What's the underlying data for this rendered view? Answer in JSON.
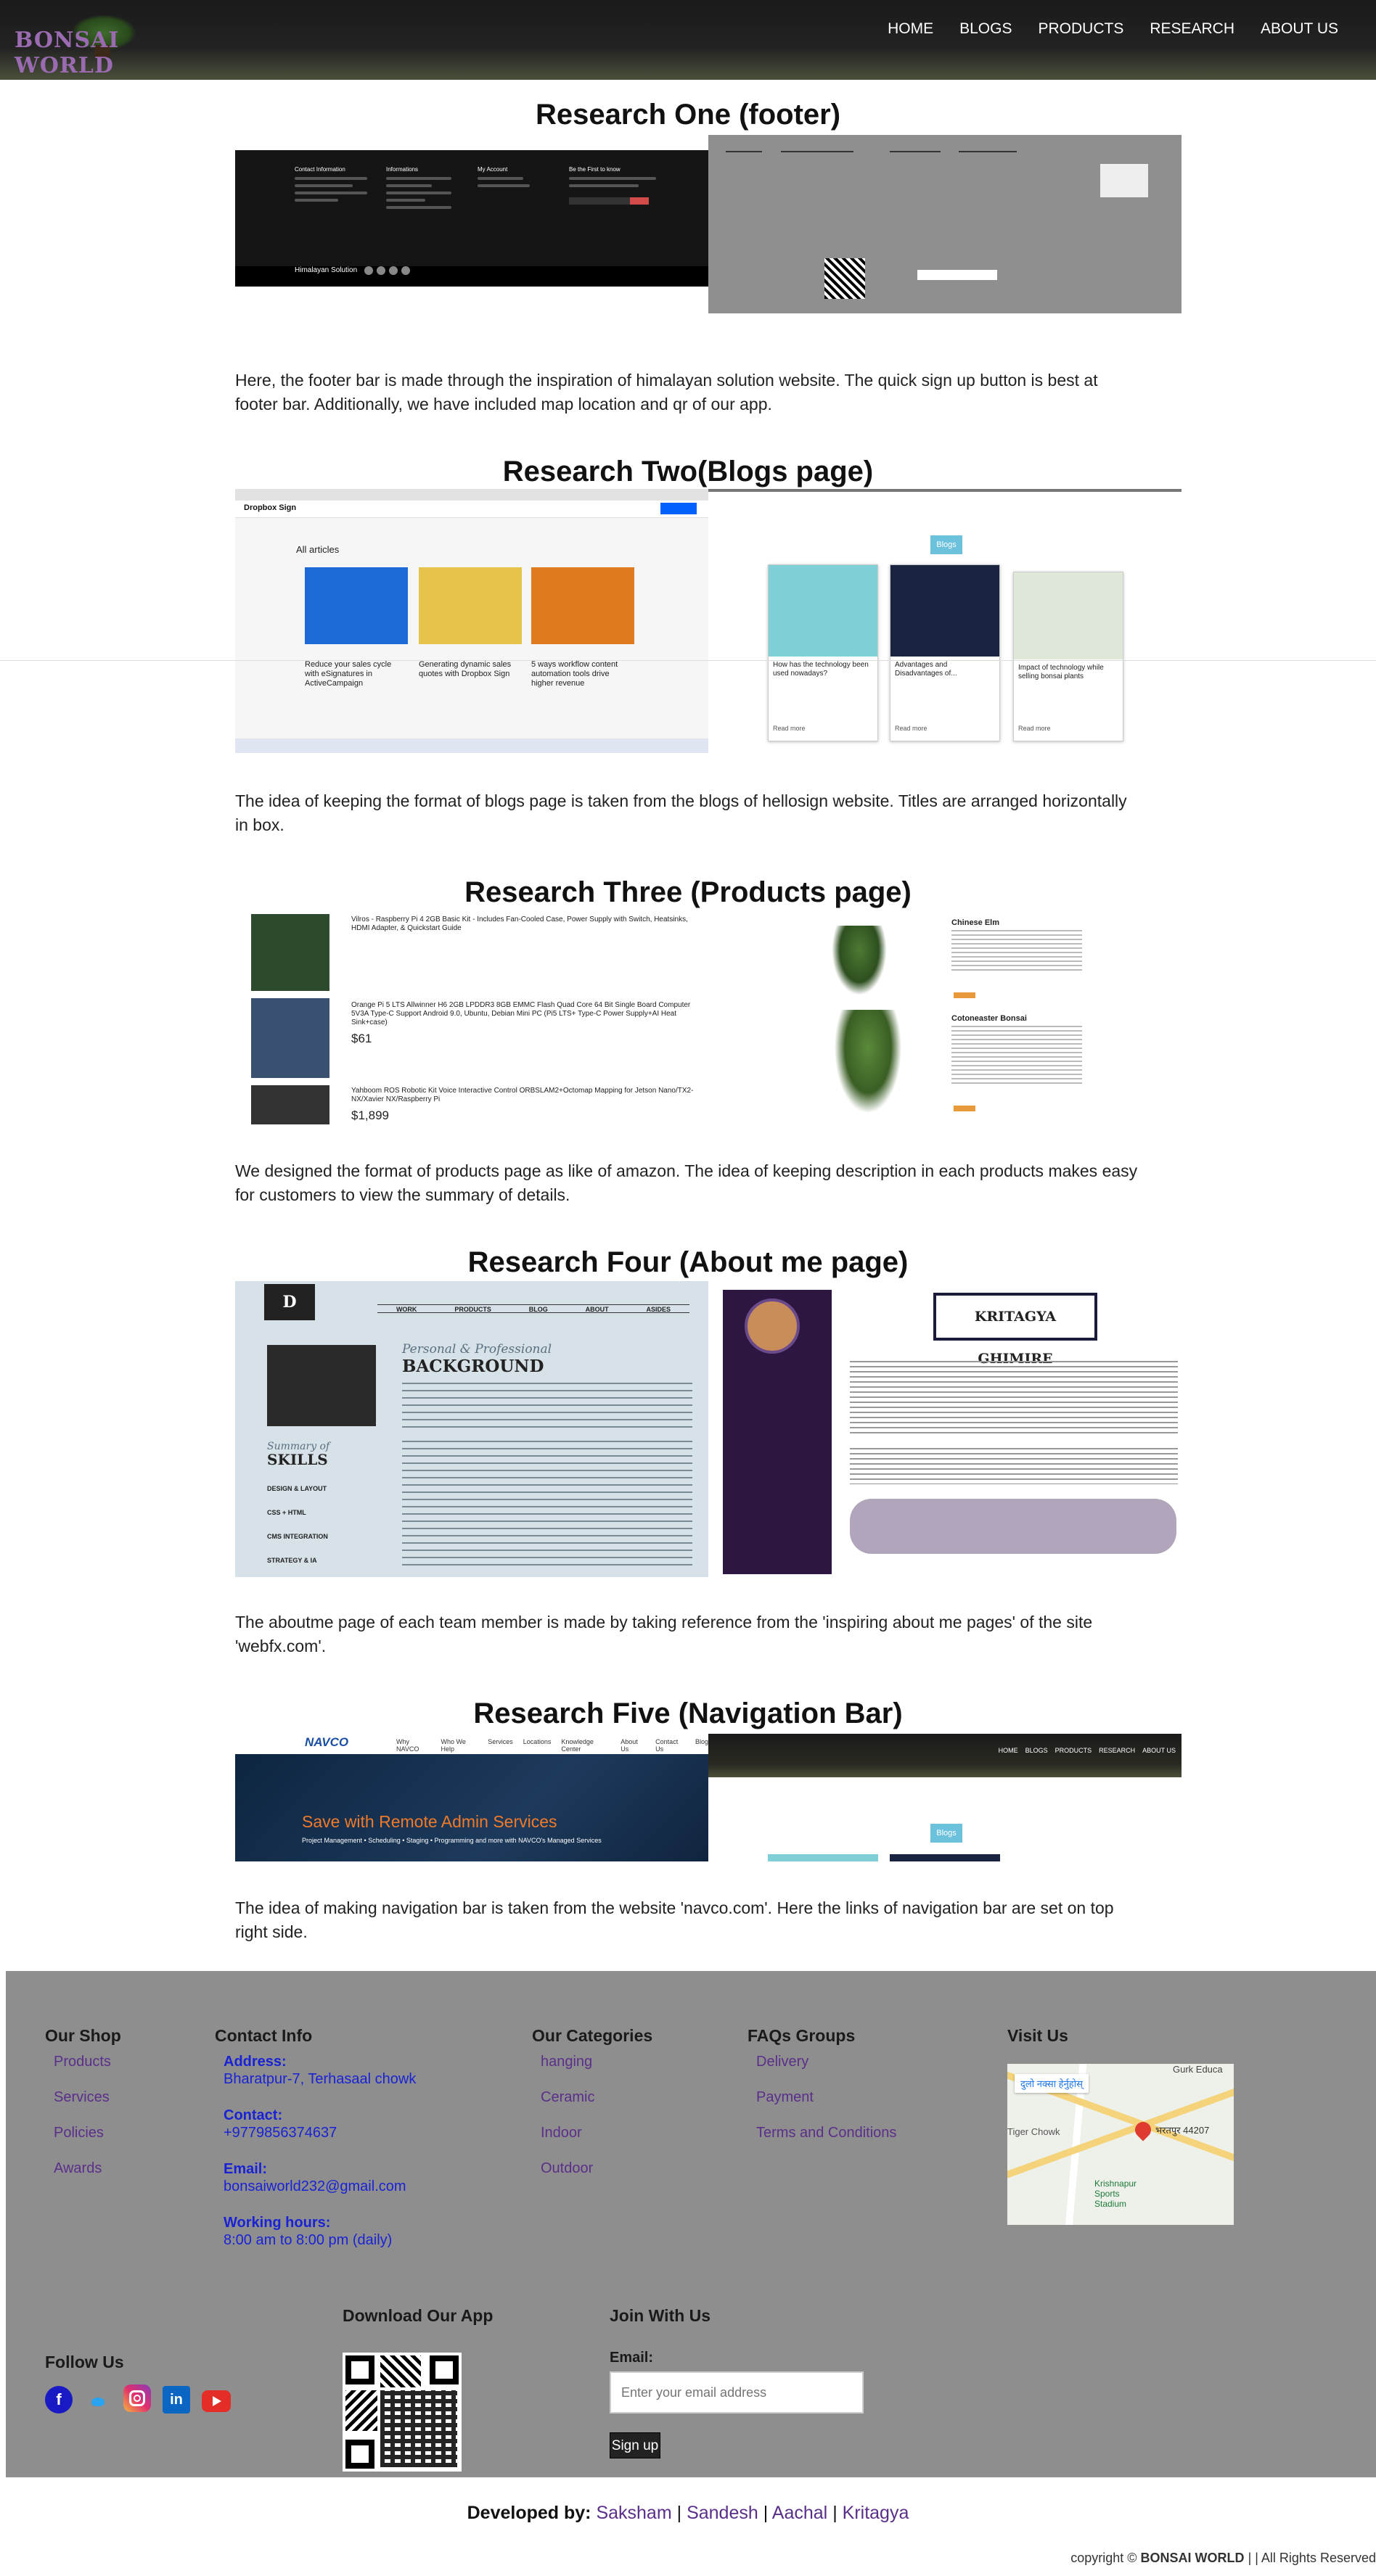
{
  "nav": {
    "logo_text": "BONSAI WORLD",
    "links": [
      "HOME",
      "BLOGS",
      "PRODUCTS",
      "RESEARCH",
      "ABOUT US"
    ]
  },
  "research": [
    {
      "title": "Research One (footer)",
      "text": "Here, the footer bar is made through the inspiration of himalayan solution website. The quick sign up button is best at footer bar. Additionally, we have included map location and qr of our app."
    },
    {
      "title": "Research Two(Blogs page)",
      "text": "The idea of keeping the format of blogs page is taken from the blogs of hellosign website. Titles are arranged horizontally in box."
    },
    {
      "title": "Research Three (Products page)",
      "text": "We designed the format of products page as like of amazon. The idea of keeping description in each products makes easy for customers to view the summary of details."
    },
    {
      "title": "Research Four (About me page)",
      "text": "The aboutme page of each team member is made by taking reference from the 'inspiring about me pages' of the site 'webfx.com'."
    },
    {
      "title": "Research Five (Navigation Bar)",
      "text": "The idea of making navigation bar is taken from the website 'navco.com'. Here the links of navigation bar are set on top right side."
    }
  ],
  "shots": {
    "himalayan_footer_label": "Himalayan Solution",
    "dropbox_heading": "All articles",
    "dropbox_brand": "Dropbox Sign",
    "dropbox_titles": [
      "Reduce your sales cycle with eSignatures in ActiveCampaign",
      "Generating dynamic sales quotes with Dropbox Sign",
      "5 ways workflow content automation tools drive higher revenue"
    ],
    "blog_badge": "Blogs",
    "blog_cards": [
      "How has the technology been used nowadays?",
      "Advantages and Disadvantages of...",
      "Impact of technology while selling bonsai plants"
    ],
    "blog_read_more": "Read more",
    "amazon_products": [
      {
        "title": "Vilros - Raspberry Pi 4 2GB Basic Kit - Includes Fan-Cooled Case, Power Supply with Switch, Heatsinks, HDMI Adapter, & Quickstart Guide",
        "price": ""
      },
      {
        "title": "Orange Pi 5 LTS Allwinner H6 2GB LPDDR3 8GB EMMC Flash Quad Core 64 Bit Single Board Computer 5V3A Type-C Support Android 9.0, Ubuntu, Debian Mini PC (Pi5 LTS+ Type-C Power Supply+AI Heat Sink+case)",
        "price": "$61"
      },
      {
        "title": "Yahboom ROS Robotic Kit Voice Interactive Control ORBSLAM2+Octomap Mapping for Jetson Nano/TX2-NX/Xavier NX/Raspberry Pi",
        "price": "$1,899"
      }
    ],
    "bonsai_products": [
      "Chinese Elm",
      "Cotoneaster Bonsai"
    ],
    "webfx_labels": {
      "work": "WORK",
      "products": "PRODUCTS",
      "blog": "BLOG",
      "about": "ABOUT",
      "asides": "ASIDES",
      "personal": "Personal & Professional",
      "background": "BACKGROUND",
      "summary": "Summary of",
      "skills": "SKILLS",
      "d_logo": "D"
    },
    "webfx_skills": [
      "DESIGN & LAYOUT",
      "CSS + HTML",
      "CMS INTEGRATION",
      "STRATEGY & IA"
    ],
    "kritagya_name": "KRITAGYA GHIMIRE",
    "navco_logo": "NAVCO",
    "navco_links": [
      "Why NAVCO",
      "Who We Help",
      "Services",
      "Locations",
      "Knowledge Center",
      "About Us",
      "Contact Us",
      "Blog"
    ],
    "navco_banner": "Save with Remote Admin Services",
    "navco_sub": "Project Management • Scheduling • Staging • Programming and more with NAVCO's Managed Services"
  },
  "footer": {
    "our_shop": {
      "heading": "Our Shop",
      "items": [
        "Products",
        "Services",
        "Policies",
        "Awards"
      ]
    },
    "contact": {
      "heading": "Contact Info",
      "address_label": "Address:",
      "address": "Bharatpur-7, Terhasaal chowk",
      "contact_label": "Contact:",
      "contact": "+9779856374637",
      "email_label": "Email:",
      "email": "bonsaiworld232@gmail.com",
      "hours_label": "Working hours:",
      "hours": "8:00 am to 8:00 pm (daily)"
    },
    "categories": {
      "heading": "Our Categories",
      "items": [
        "hanging",
        "Ceramic",
        "Indoor",
        "Outdoor"
      ]
    },
    "faqs": {
      "heading": "FAQs Groups",
      "items": [
        "Delivery",
        "Payment",
        "Terms and Conditions"
      ]
    },
    "visit": {
      "heading": "Visit Us",
      "map_labels": {
        "place1": "Tiger Chowk",
        "place2": "भरतपुर 44207",
        "place3": "Krishnapur Sports Stadium",
        "place4": "दुलो नक्सा हेर्नुहोस्",
        "place5": "Gurk Educa"
      }
    },
    "follow": {
      "heading": "Follow Us",
      "icons": [
        "facebook-icon",
        "twitter-icon",
        "instagram-icon",
        "linkedin-icon",
        "youtube-icon"
      ]
    },
    "download": {
      "heading": "Download Our App"
    },
    "join": {
      "heading": "Join With Us",
      "email_label": "Email:",
      "placeholder": "Enter your email address",
      "button": "Sign up"
    }
  },
  "credits": {
    "developed_by": "Developed by:",
    "names": [
      "Saksham",
      "Sandesh",
      "Aachal",
      "Kritagya"
    ],
    "sep": "|",
    "copyright_prefix": "copyright ©",
    "brand": "BONSAI WORLD",
    "rights": "| | All Rights Reserved"
  },
  "colors": {
    "accent_purple": "#5a2f8a",
    "link_blue": "#1a23d4",
    "footer_grey": "#8e8e8e"
  }
}
